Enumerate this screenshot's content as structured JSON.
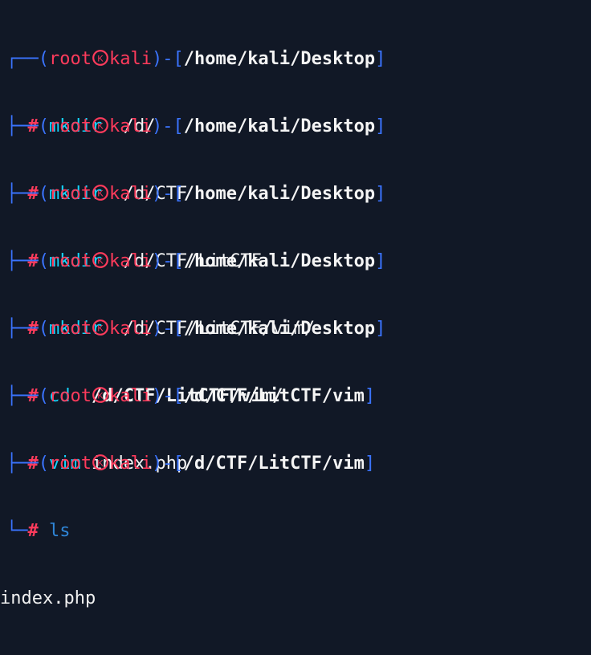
{
  "terminal": {
    "background": "#111826",
    "prompt": {
      "user": "root",
      "host": "kali",
      "hash": "#",
      "open_bracket": "(",
      "close_bracket": ")",
      "path_open": "[",
      "path_close": "]",
      "corner_top": "┌──",
      "corner_bottom": "└─",
      "dash": "-"
    },
    "entries": [
      {
        "cwd": "/home/kali/Desktop",
        "command": "mkdir",
        "args": "/d/"
      },
      {
        "cwd": "/home/kali/Desktop",
        "command": "mkdir",
        "args": "/d/CTF"
      },
      {
        "cwd": "/home/kali/Desktop",
        "command": "mkdir",
        "args": "/d/CTF/LitCTF"
      },
      {
        "cwd": "/home/kali/Desktop",
        "command": "mkdir",
        "args": "/d/CTF/LitCTF/vim/"
      },
      {
        "cwd": "/home/kali/Desktop",
        "command": "cd",
        "args": "/d/CTF/LitCTF/vim/"
      },
      {
        "cwd": "/d/CTF/LitCTF/vim",
        "command": "vim",
        "args": "index.php"
      },
      {
        "cwd": "/d/CTF/LitCTF/vim",
        "command": "ls",
        "args": ""
      }
    ],
    "output": "index.php",
    "icon": "kali-skull-icon"
  }
}
